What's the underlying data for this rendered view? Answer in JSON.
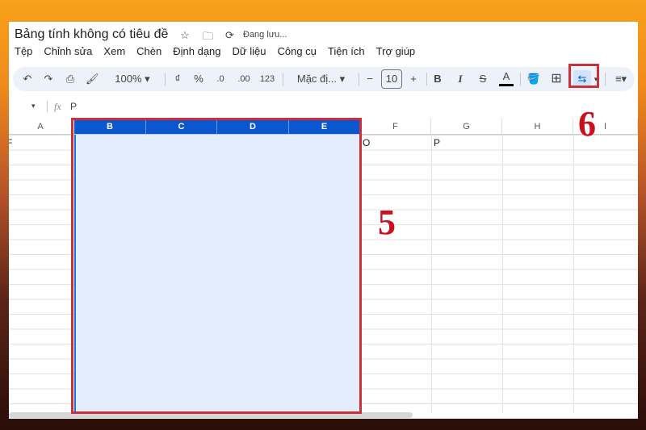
{
  "title": "Bảng tính không có tiêu đề",
  "saving": "Đang lưu...",
  "menu": [
    "Tệp",
    "Chỉnh sửa",
    "Xem",
    "Chèn",
    "Định dạng",
    "Dữ liệu",
    "Công cụ",
    "Tiện ích",
    "Trợ giúp"
  ],
  "toolbar": {
    "zoom": "100%",
    "currency": "₫",
    "percent": "%",
    "dec_less": ".0",
    "dec_more": ".00",
    "number_format": "123",
    "font": "Mặc đị...",
    "font_size": "10",
    "bold": "B",
    "italic": "I",
    "text_color": "A"
  },
  "formula": {
    "fx": "fx",
    "value": "P"
  },
  "columns": [
    "A",
    "B",
    "C",
    "D",
    "E",
    "F",
    "G",
    "H",
    "I"
  ],
  "cells": {
    "A1": "F",
    "F1": "O",
    "G1": "P"
  },
  "annotations": {
    "selection": "5",
    "merge": "6"
  },
  "colors": {
    "selected_header": "#0b57d0",
    "highlight": "#c8303a"
  }
}
